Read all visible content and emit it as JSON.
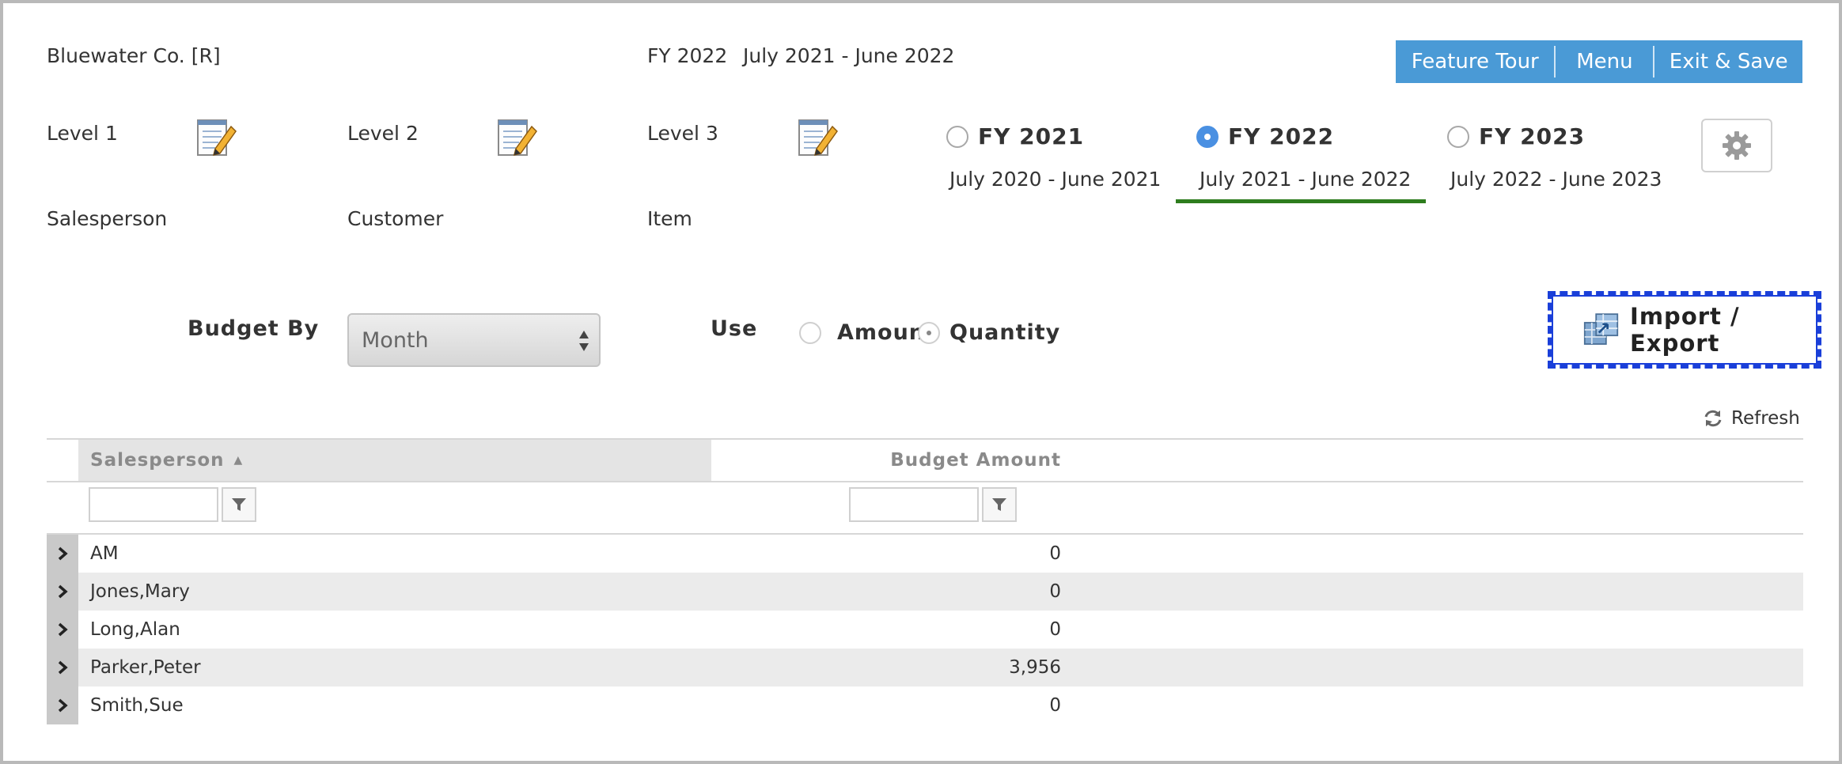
{
  "header": {
    "company": "Bluewater Co. [R]",
    "fy_title": "FY 2022",
    "fy_range": "July 2021 - June 2022"
  },
  "topbar": {
    "feature_tour": "Feature Tour",
    "menu": "Menu",
    "exit_save": "Exit & Save",
    "color": "#4a9ad6"
  },
  "levels": [
    {
      "label": "Level 1",
      "value": "Salesperson",
      "icon": "edit-icon"
    },
    {
      "label": "Level 2",
      "value": "Customer",
      "icon": "edit-icon"
    },
    {
      "label": "Level 3",
      "value": "Item",
      "icon": "edit-icon"
    }
  ],
  "fiscal_years": [
    {
      "label": "FY 2021",
      "range": "July 2020 - June 2021",
      "selected": false
    },
    {
      "label": "FY 2022",
      "range": "July 2021 - June 2022",
      "selected": true
    },
    {
      "label": "FY 2023",
      "range": "July 2022 - June 2023",
      "selected": false
    }
  ],
  "settings": {
    "icon": "gear-icon"
  },
  "budget_by": {
    "label": "Budget By",
    "selected": "Month"
  },
  "use": {
    "label": "Use",
    "options": [
      "Amount",
      "Quantity"
    ]
  },
  "import_export": {
    "label": "Import / Export",
    "icon": "import-export-icon",
    "highlight_color": "#1a3fd9"
  },
  "refresh": {
    "label": "Refresh",
    "icon": "refresh-icon"
  },
  "grid": {
    "columns": [
      "Salesperson",
      "Budget Amount"
    ],
    "rows": [
      {
        "name": "AM",
        "amount": "0"
      },
      {
        "name": "Jones,Mary",
        "amount": "0"
      },
      {
        "name": "Long,Alan",
        "amount": "0"
      },
      {
        "name": "Parker,Peter",
        "amount": "3,956"
      },
      {
        "name": "Smith,Sue",
        "amount": "0"
      }
    ]
  },
  "colors": {
    "accent": "#4a9ad6",
    "selected_tab_underline": "#2e7d1e",
    "radio_selected": "#4a90e2"
  }
}
